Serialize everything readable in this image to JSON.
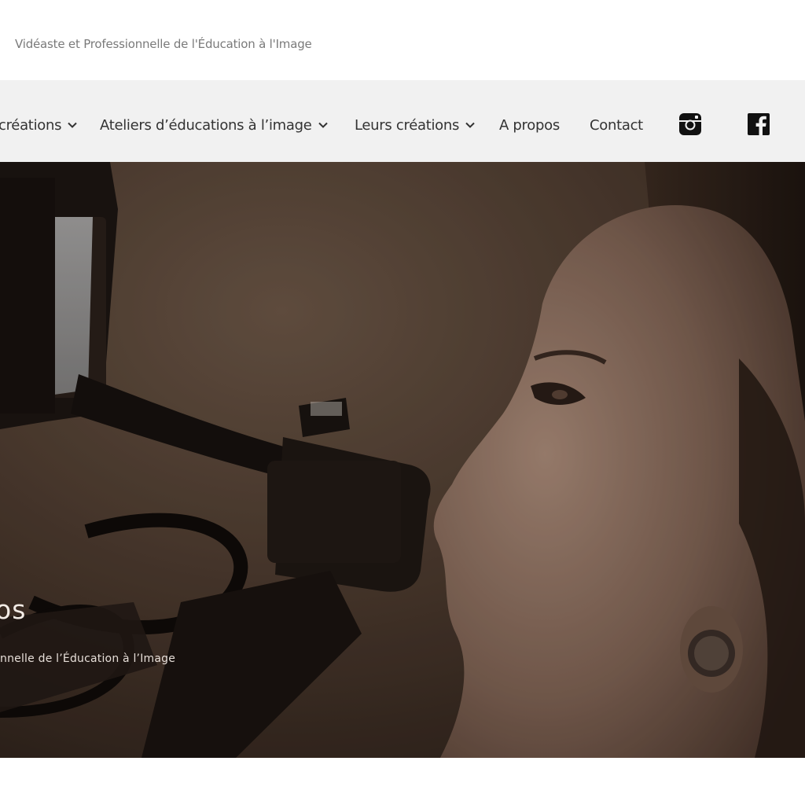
{
  "header": {
    "tagline": "Vidéaste et Professionnelle de l'Éducation à l'Image"
  },
  "nav": {
    "items": [
      {
        "label": "créations",
        "has_dropdown": true
      },
      {
        "label": "Ateliers d’éducations à l’image",
        "has_dropdown": true
      },
      {
        "label": "Leurs créations",
        "has_dropdown": true
      },
      {
        "label": "A propos",
        "has_dropdown": false
      },
      {
        "label": "Contact",
        "has_dropdown": false
      }
    ],
    "social": [
      {
        "icon": "instagram-icon"
      },
      {
        "icon": "facebook-icon"
      }
    ]
  },
  "hero": {
    "title": "os",
    "subtitle": "nnelle de l’Éducation à l’Image",
    "image": "woman-looking-through-camera-viewfinder"
  },
  "colors": {
    "nav_background": "#f1f1f1",
    "nav_text": "#333333",
    "tagline_text": "#7a7a7a",
    "hero_text": "#f3ece6"
  }
}
